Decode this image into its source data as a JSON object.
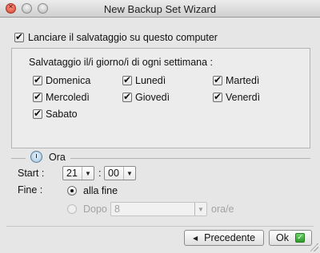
{
  "window": {
    "title": "New Backup Set Wizard"
  },
  "run_on_computer": {
    "label": "Lanciare il salvataggio su questo computer",
    "checked": true
  },
  "days": {
    "heading": "Salvataggio il/i giorno/i di ogni settimana :",
    "items": [
      {
        "label": "Domenica",
        "checked": true
      },
      {
        "label": "Lunedì",
        "checked": true
      },
      {
        "label": "Martedì",
        "checked": true
      },
      {
        "label": "Mercoledì",
        "checked": true
      },
      {
        "label": "Giovedì",
        "checked": true
      },
      {
        "label": "Venerdì",
        "checked": true
      },
      {
        "label": "Sabato",
        "checked": true
      }
    ]
  },
  "ora": {
    "legend": "Ora",
    "start_label": "Start :",
    "hour_value": "21",
    "separator": ":",
    "minute_value": "00",
    "end_label": "Fine :",
    "option_end": {
      "label": "alla fine",
      "selected": true
    },
    "option_after": {
      "label": "Dopo",
      "selected": false,
      "enabled": false
    },
    "after_value": "8",
    "after_unit": "ora/e"
  },
  "buttons": {
    "previous": "Precedente",
    "ok": "Ok"
  },
  "icons": {
    "close": "close-icon",
    "back": "arrow-left-icon",
    "ok": "check-icon",
    "clock": "clock-icon"
  },
  "colors": {
    "ok_accent": "#2f9a2a",
    "close_button": "#d6402c"
  }
}
